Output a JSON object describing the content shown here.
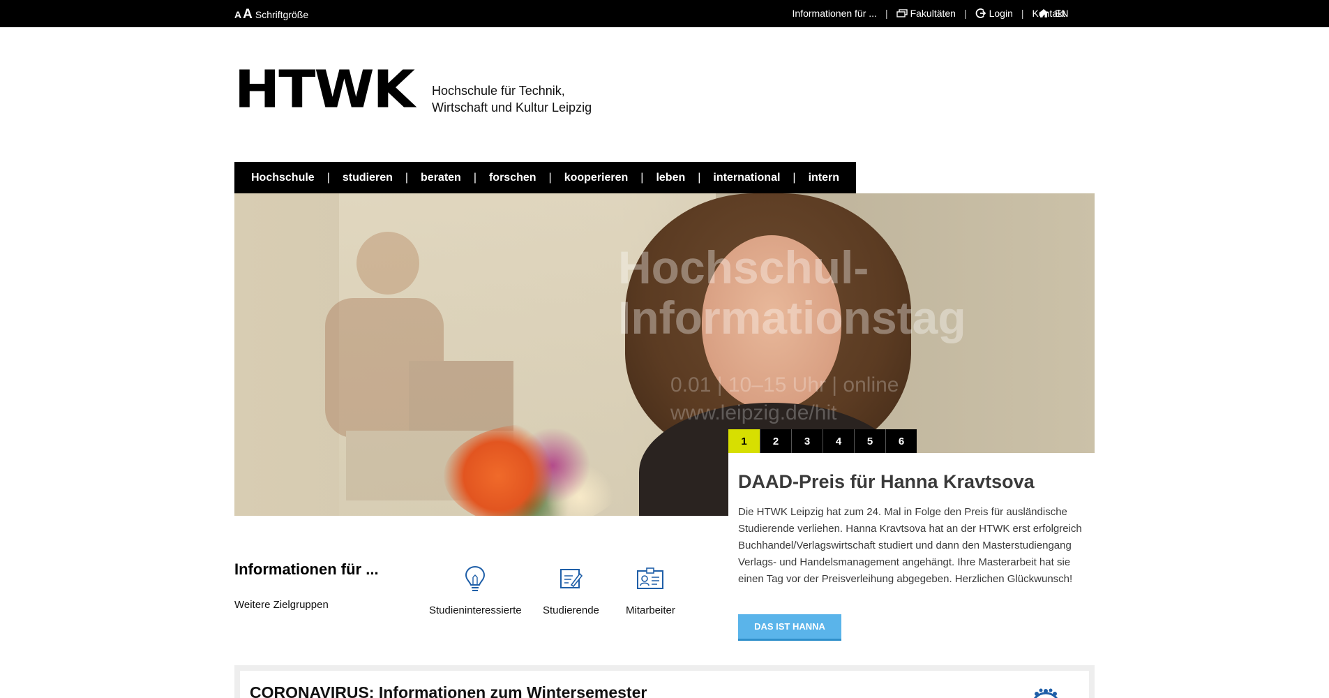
{
  "topbar": {
    "font_small": "A",
    "font_big": "A",
    "font_label": "Schriftgröße",
    "info_for": "Informationen für ...",
    "faculties": "Fakultäten",
    "login": "Login",
    "contact": "Kontakt",
    "language": "EN",
    "sep": "|"
  },
  "logo": {
    "mark": "HTWK",
    "line1": "Hochschule für Technik,",
    "line2": "Wirtschaft und Kultur Leipzig"
  },
  "nav": {
    "items": [
      "Hochschule",
      "studieren",
      "beraten",
      "forschen",
      "kooperieren",
      "leben",
      "international",
      "intern"
    ],
    "sep": "|"
  },
  "hero": {
    "overlay_line1": "Hochschul-",
    "overlay_line2": "Informationstag",
    "overlay_sub1": "0.01 | 10–15 Uhr | online",
    "overlay_sub2": "www.leipzig.de/hit"
  },
  "pager": {
    "pages": [
      "1",
      "2",
      "3",
      "4",
      "5",
      "6"
    ],
    "active": "1"
  },
  "news": {
    "title": "DAAD-Preis für Hanna Kravtsova",
    "text": "Die HTWK Leipzig hat zum 24. Mal in Folge den Preis für ausländische Studierende verliehen. Hanna Kravtsova hat an der HTWK erst erfolgreich Buchhandel/Verlagswirtschaft studiert und dann den Masterstudiengang Verlags- und Handelsmanagement angehängt. Ihre Masterarbeit hat sie einen Tag vor der Preisverleihung abgegeben. Herzlichen Glückwunsch!",
    "button": "DAS IST HANNA"
  },
  "info": {
    "title": "Informationen für ...",
    "more": "Weitere Zielgruppen",
    "targets": [
      {
        "label": "Studieninteressierte",
        "icon": "lightbulb-icon"
      },
      {
        "label": "Studierende",
        "icon": "notepad-icon"
      },
      {
        "label": "Mitarbeiter",
        "icon": "id-card-icon"
      }
    ]
  },
  "corona": {
    "title": "CORONAVIRUS: Informationen zum Wintersemester"
  },
  "colors": {
    "accent_yellow": "#d7df01",
    "button_blue": "#5ab4ea",
    "icon_blue": "#1f5fa8"
  }
}
